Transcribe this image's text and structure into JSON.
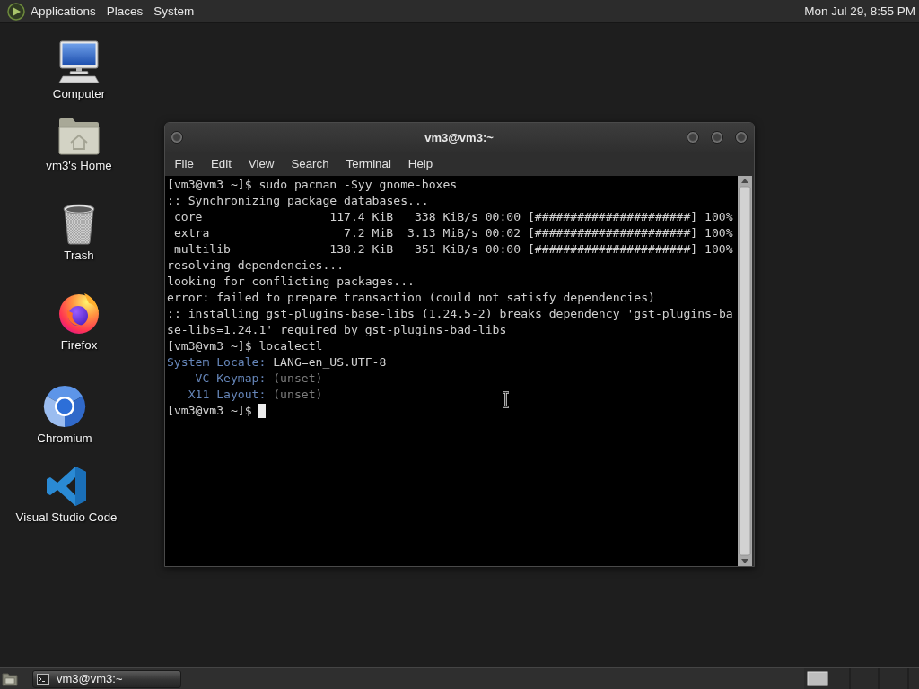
{
  "top_panel": {
    "menus": [
      "Applications",
      "Places",
      "System"
    ],
    "clock": "Mon Jul 29, 8:55 PM"
  },
  "desktop_icons": [
    {
      "kind": "computer",
      "label": "Computer"
    },
    {
      "kind": "home",
      "label": "vm3's Home"
    },
    {
      "kind": "trash",
      "label": "Trash"
    },
    {
      "kind": "firefox",
      "label": "Firefox"
    },
    {
      "kind": "chromium",
      "label": "Chromium"
    },
    {
      "kind": "vscode",
      "label": "Visual Studio Code"
    }
  ],
  "terminal_window": {
    "title": "vm3@vm3:~",
    "menu": [
      "File",
      "Edit",
      "View",
      "Search",
      "Terminal",
      "Help"
    ],
    "lines": [
      {
        "kind": "text",
        "text": "[vm3@vm3 ~]$ sudo pacman -Syy gnome-boxes"
      },
      {
        "kind": "text",
        "text": ":: Synchronizing package databases..."
      },
      {
        "kind": "progress",
        "repo": "core",
        "size": "117.4 KiB",
        "speed": "338 KiB/s",
        "time": "00:00",
        "bar": "[######################]",
        "percent": "100%"
      },
      {
        "kind": "progress",
        "repo": "extra",
        "size": "7.2 MiB",
        "speed": "3.13 MiB/s",
        "time": "00:02",
        "bar": "[######################]",
        "percent": "100%"
      },
      {
        "kind": "progress",
        "repo": "multilib",
        "size": "138.2 KiB",
        "speed": "351 KiB/s",
        "time": "00:00",
        "bar": "[######################]",
        "percent": "100%"
      },
      {
        "kind": "text",
        "text": "resolving dependencies..."
      },
      {
        "kind": "text",
        "text": "looking for conflicting packages..."
      },
      {
        "kind": "text",
        "text": "error: failed to prepare transaction (could not satisfy dependencies)"
      },
      {
        "kind": "text",
        "text": ":: installing gst-plugins-base-libs (1.24.5-2) breaks dependency 'gst-plugins-base-libs=1.24.1' required by gst-plugins-bad-libs"
      },
      {
        "kind": "text",
        "text": "[vm3@vm3 ~]$ localectl"
      },
      {
        "kind": "property",
        "label": "System Locale:",
        "value": "LANG=en_US.UTF-8",
        "dim": false
      },
      {
        "kind": "property",
        "label": "VC Keymap:",
        "value": "(unset)",
        "dim": true
      },
      {
        "kind": "property",
        "label": "X11 Layout:",
        "value": "(unset)",
        "dim": true
      },
      {
        "kind": "prompt",
        "text": "[vm3@vm3 ~]$",
        "cursor": true
      }
    ]
  },
  "taskbar": {
    "tasks": [
      {
        "label": "vm3@vm3:~"
      }
    ]
  }
}
